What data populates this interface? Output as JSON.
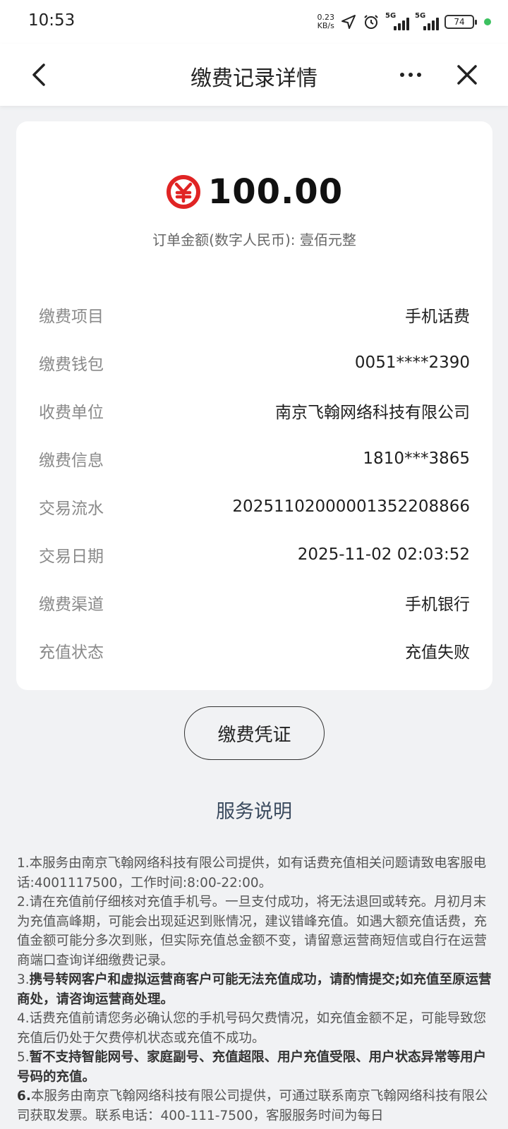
{
  "status_bar": {
    "time": "10:53",
    "net_speed_value": "0.23",
    "net_speed_unit": "KB/s",
    "sim1_label": "5G",
    "sim2_label": "5G",
    "battery": "74",
    "icons": [
      "location-arrow-icon",
      "alarm-icon",
      "signal-icon",
      "battery-icon"
    ]
  },
  "nav": {
    "title": "缴费记录详情",
    "icons": [
      "back-icon",
      "more-icon",
      "close-icon"
    ]
  },
  "detail": {
    "currency_icon": "digital-rmb-icon",
    "accent_color": "#e02424",
    "amount": "100.00",
    "amount_caption": "订单金额(数字人民币): 壹佰元整",
    "rows": [
      {
        "label": "缴费项目",
        "value": "手机话费"
      },
      {
        "label": "缴费钱包",
        "value": "0051****2390"
      },
      {
        "label": "收费单位",
        "value": "南京飞翰网络科技有限公司"
      },
      {
        "label": "缴费信息",
        "value": "1810***3865"
      },
      {
        "label": "交易流水",
        "value": "20251102000001352208866"
      },
      {
        "label": "交易日期",
        "value": "2025-11-02 02:03:52"
      },
      {
        "label": "缴费渠道",
        "value": "手机银行"
      },
      {
        "label": "充值状态",
        "value": "充值失败"
      }
    ]
  },
  "voucher_button": "缴费凭证",
  "service": {
    "title": "服务说明",
    "notes": [
      {
        "num": "1.",
        "text": "本服务由南京飞翰网络科技有限公司提供，如有话费充值相关问题请致电客服电话:4001117500，工作时间:8:00-22:00。",
        "bold": false
      },
      {
        "num": "2.",
        "text": "请在充值前仔细核对充值手机号。一旦支付成功，将无法退回或转充。月初月末为充值高峰期，可能会出现延迟到账情况，建议错峰充值。如遇大额充值话费，充值金额可能分多次到账，但实际充值总金额不变，请留意运营商短信或自行在运营商端口查询详细缴费记录。",
        "bold": false
      },
      {
        "num": "3.",
        "text": "携号转网客户和虚拟运营商客户可能无法充值成功，请酌情提交;如充值至原运营商处，请咨询运营商处理。",
        "bold": true
      },
      {
        "num": "4.",
        "text": "话费充值前请您务必确认您的手机号码欠费情况，如充值金额不足，可能导致您充值后仍处于欠费停机状态或充值不成功。",
        "bold": false
      },
      {
        "num": "5.",
        "text": "暂不支持智能网号、家庭副号、充值超限、用户充值受限、用户状态异常等用户号码的充值。",
        "bold": true
      },
      {
        "num": "6.",
        "text": "本服务由南京飞翰网络科技有限公司提供，可通过联系南京飞翰网络科技有限公司获取发票。联系电话：400-111-7500，客服服务时间为每日",
        "bold": false
      }
    ]
  }
}
